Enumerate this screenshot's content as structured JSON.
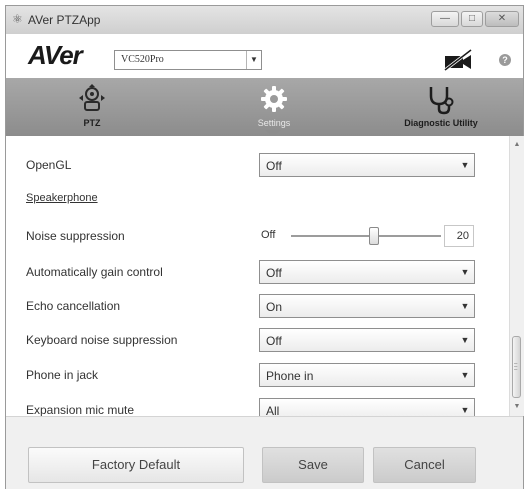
{
  "window": {
    "title": "AVer PTZApp",
    "min_label": "—",
    "max_label": "□",
    "close_label": "✕"
  },
  "header": {
    "logo_text": "AVer",
    "model_value": "VC520Pro",
    "help_label": "?"
  },
  "nav": {
    "ptz_label": "PTZ",
    "settings_label": "Settings",
    "diagnostic_label": "Diagnostic Utility"
  },
  "settings": {
    "opengl": {
      "label": "OpenGL",
      "value": "Off"
    },
    "speakerphone_title": "Speakerphone",
    "noise_suppression": {
      "label": "Noise suppression",
      "min_label": "Off",
      "value": "20",
      "level_percent": 55
    },
    "agc": {
      "label": "Automatically gain control",
      "value": "Off"
    },
    "echo": {
      "label": "Echo cancellation",
      "value": "On"
    },
    "keyboard_noise": {
      "label": "Keyboard noise suppression",
      "value": "Off"
    },
    "phone_jack": {
      "label": "Phone in jack",
      "value": "Phone in"
    },
    "expansion_mic": {
      "label": "Expansion mic mute",
      "value": "All"
    }
  },
  "footer": {
    "factory_label": "Factory Default",
    "save_label": "Save",
    "cancel_label": "Cancel"
  },
  "icons": {
    "dropdown": "▼",
    "scroll_up": "▲",
    "scroll_down": "▼"
  }
}
